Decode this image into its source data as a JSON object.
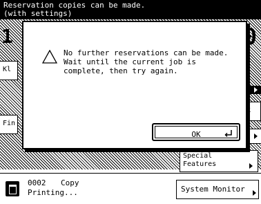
{
  "top_message": "Reservation copies can be made.\n(with settings)",
  "background": {
    "copy_count_left": "1",
    "copy_count_right": "0",
    "left_button_1_label": "Kl",
    "left_button_2_label": "Fin",
    "right_button_1_label": "k",
    "special_features_label": "Special\nFeatures"
  },
  "dialog": {
    "icon": "warning-triangle-icon",
    "message": "No further reservations can be made. Wait until the current job is complete, then try again.",
    "ok_label": "OK",
    "ok_icon": "enter-return-icon"
  },
  "status_bar": {
    "job_id": "0002",
    "job_type": "Copy",
    "job_status": "Printing...",
    "system_monitor_label": "System Monitor"
  }
}
